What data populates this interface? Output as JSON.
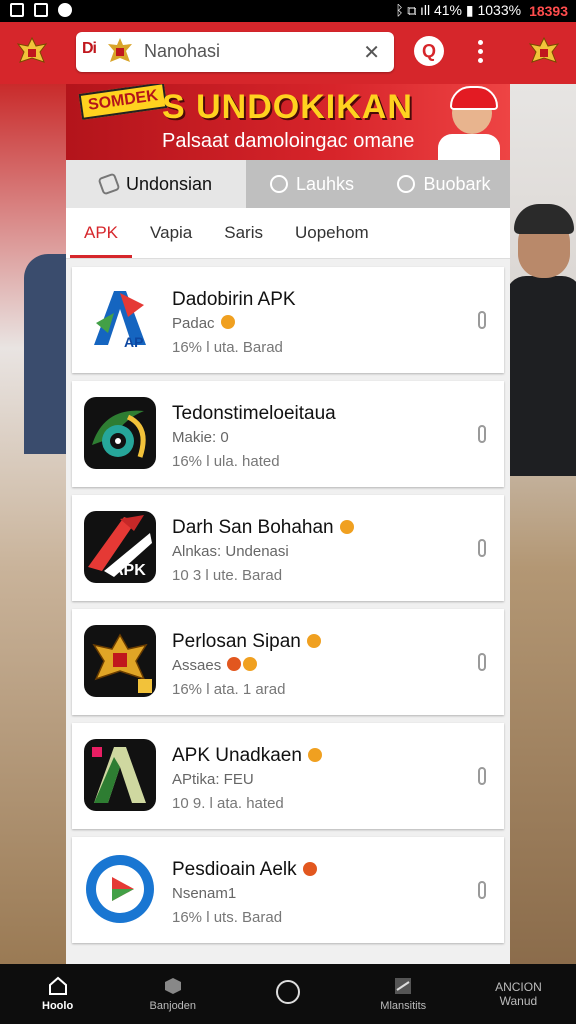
{
  "status_bar": {
    "right_text": "ᛒ ⧉ ıll 41% ▮ 1033%",
    "clock": "18393"
  },
  "header": {
    "search_logo": "Di",
    "search_text": "Nanohasi",
    "clear_icon": "✕",
    "q_button": "Q"
  },
  "banner": {
    "sticker": "SOMDEK",
    "headline": "S UNDOKIKAN",
    "subline": "Palsaat damoloingac omane"
  },
  "tabs_primary": [
    {
      "label": "Undonsian",
      "icon": "tag-icon",
      "active": true
    },
    {
      "label": "Lauhks",
      "icon": "link-icon",
      "active": false
    },
    {
      "label": "Buobark",
      "icon": "bookmark-icon",
      "active": false
    }
  ],
  "tabs_secondary": [
    {
      "label": "APK",
      "active": true
    },
    {
      "label": "Vapia",
      "active": false
    },
    {
      "label": "Saris",
      "active": false
    },
    {
      "label": "Uopehom",
      "active": false
    }
  ],
  "apps": [
    {
      "title": "Dadobirin APK",
      "subtitle": "Padac",
      "meta": "16% l uta. Barad",
      "icon": "ap-logo-icon"
    },
    {
      "title": "Tedonstimeloeitaua",
      "subtitle": "Makie: 0",
      "meta": "16% l ula. hated",
      "icon": "eye-swirl-icon"
    },
    {
      "title": "Darh San Bohahan",
      "subtitle": "Alnkas: Undenasi",
      "meta": "10 3 l ute. Barad",
      "icon": "apk-red-icon"
    },
    {
      "title": "Perlosan Sipan",
      "subtitle": "Assaes",
      "meta": "16% l ata. 1 arad",
      "icon": "garuda-icon"
    },
    {
      "title": "APK Unadkaen",
      "subtitle": "APtika: FEU",
      "meta": "10 9. l ata. hated",
      "icon": "a-letter-icon"
    },
    {
      "title": "Pesdioain Aelk",
      "subtitle": "Nsenam1",
      "meta": "16% l uts. Barad",
      "icon": "play-circle-icon"
    }
  ],
  "bottom_nav": [
    {
      "label": "Hoolo",
      "icon": "home-icon",
      "active": true
    },
    {
      "label": "Banjoden",
      "icon": "cube-icon",
      "active": false
    },
    {
      "label": "",
      "icon": "info-icon",
      "active": false
    },
    {
      "label": "Mlansitits",
      "icon": "plane-icon",
      "active": false
    },
    {
      "label": "ANCION Wanud",
      "icon": "text-icon",
      "active": false
    }
  ],
  "colors": {
    "brand_red": "#d6262b",
    "accent_yellow": "#ffd21f"
  }
}
